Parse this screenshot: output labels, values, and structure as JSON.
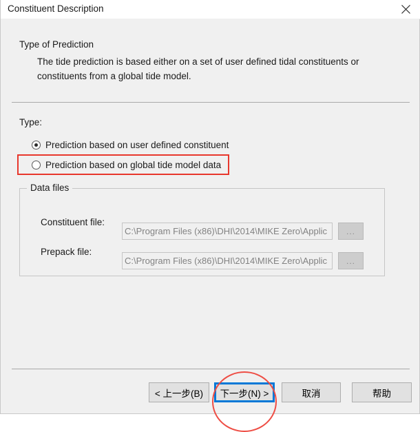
{
  "window": {
    "title": "Constituent Description",
    "close_icon": "close-icon"
  },
  "content": {
    "heading": "Type of Prediction",
    "description": "The tide prediction is based either on a set of user defined tidal constituents or constituents from a global tide model.",
    "type_label": "Type:",
    "radios": [
      {
        "label": "Prediction based on user defined constituent",
        "checked": true
      },
      {
        "label": "Prediction based on global tide model data",
        "checked": false
      }
    ]
  },
  "data_files": {
    "legend": "Data files",
    "fields": [
      {
        "label": "Constituent file:",
        "value": "C:\\Program Files (x86)\\DHI\\2014\\MIKE Zero\\Applic",
        "browse_label": "..."
      },
      {
        "label": "Prepack file:",
        "value": "C:\\Program Files (x86)\\DHI\\2014\\MIKE Zero\\Applic",
        "browse_label": "..."
      }
    ]
  },
  "footer": {
    "back": "< 上一步(B)",
    "next": "下一步(N) >",
    "cancel": "取消",
    "help": "帮助"
  },
  "annotations": {
    "highlight_color": "#e8372c",
    "ellipse_color": "#ee4d44",
    "focus_color": "#0078d7"
  }
}
